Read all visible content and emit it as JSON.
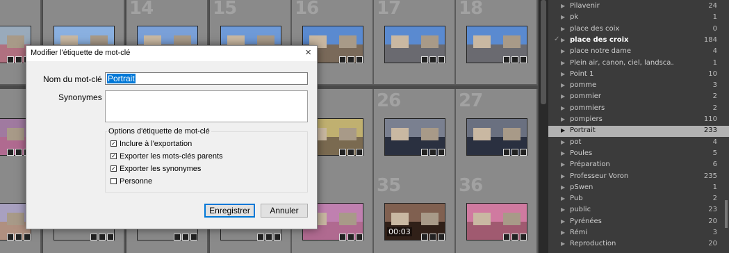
{
  "grid": {
    "cells": [
      {
        "num": "",
        "sky": "#9ab",
        "ground": "#b07080"
      },
      {
        "num": "",
        "sky": "#8ab0e0",
        "ground": "#a89070"
      },
      {
        "num": "14",
        "sky": "#7aa0d8",
        "ground": "#9a8060"
      },
      {
        "num": "15",
        "sky": "#6e9ad8",
        "ground": "#8a7a6a"
      },
      {
        "num": "16",
        "sky": "#5a8ad0",
        "ground": "#7a6a5a"
      },
      {
        "num": "17",
        "sky": "#5a8ad0",
        "ground": "#6a6a70"
      },
      {
        "num": "18",
        "sky": "#5a8ad0",
        "ground": "#6a6a70"
      },
      {
        "num": "",
        "sky": "#a07aa0",
        "ground": "#b06a90"
      },
      {
        "num": "",
        "sky": "#8a8a8a",
        "ground": "#8a8a8a"
      },
      {
        "num": "",
        "sky": "#8a8a8a",
        "ground": "#8a8a8a"
      },
      {
        "num": "",
        "sky": "#8a8a8a",
        "ground": "#8a8a8a"
      },
      {
        "num": "",
        "sky": "#c0b070",
        "ground": "#7a6a50"
      },
      {
        "num": "26",
        "sky": "#7a8090",
        "ground": "#2a3040"
      },
      {
        "num": "27",
        "sky": "#6a7080",
        "ground": "#2a3040"
      },
      {
        "num": "",
        "sky": "#a8a0c0",
        "ground": "#b09080"
      },
      {
        "num": "",
        "sky": "#8a8a8a",
        "ground": "#8a8a8a"
      },
      {
        "num": "",
        "sky": "#8a8a8a",
        "ground": "#8a8a8a"
      },
      {
        "num": "",
        "sky": "#8a8a8a",
        "ground": "#8a8a8a"
      },
      {
        "num": "",
        "sky": "#c080b0",
        "ground": "#b06a90"
      },
      {
        "num": "35",
        "sky": "#806050",
        "ground": "#302018"
      },
      {
        "num": "36",
        "sky": "#d07aa0",
        "ground": "#a05a70"
      }
    ],
    "video_time": "00:03"
  },
  "keywords": {
    "items": [
      {
        "label": "Pilavenir",
        "count": "24",
        "selected": false,
        "bold": false,
        "check": ""
      },
      {
        "label": "pk",
        "count": "1",
        "selected": false,
        "bold": false,
        "check": ""
      },
      {
        "label": "place des coix",
        "count": "0",
        "selected": false,
        "bold": false,
        "check": ""
      },
      {
        "label": "place des croix",
        "count": "184",
        "selected": false,
        "bold": true,
        "check": "✓"
      },
      {
        "label": "place notre dame",
        "count": "4",
        "selected": false,
        "bold": false,
        "check": ""
      },
      {
        "label": "Plein air, canon, ciel, landsca...",
        "count": "1",
        "selected": false,
        "bold": false,
        "check": ""
      },
      {
        "label": "Point 1",
        "count": "10",
        "selected": false,
        "bold": false,
        "check": ""
      },
      {
        "label": "pomme",
        "count": "3",
        "selected": false,
        "bold": false,
        "check": ""
      },
      {
        "label": "pommier",
        "count": "2",
        "selected": false,
        "bold": false,
        "check": ""
      },
      {
        "label": "pommiers",
        "count": "2",
        "selected": false,
        "bold": false,
        "check": ""
      },
      {
        "label": "pompiers",
        "count": "110",
        "selected": false,
        "bold": false,
        "check": ""
      },
      {
        "label": "Portrait",
        "count": "233",
        "selected": true,
        "bold": false,
        "check": ""
      },
      {
        "label": "pot",
        "count": "4",
        "selected": false,
        "bold": false,
        "check": ""
      },
      {
        "label": "Poules",
        "count": "5",
        "selected": false,
        "bold": false,
        "check": ""
      },
      {
        "label": "Préparation",
        "count": "6",
        "selected": false,
        "bold": false,
        "check": ""
      },
      {
        "label": "Professeur Voron",
        "count": "235",
        "selected": false,
        "bold": false,
        "check": ""
      },
      {
        "label": "pSwen",
        "count": "1",
        "selected": false,
        "bold": false,
        "check": ""
      },
      {
        "label": "Pub",
        "count": "2",
        "selected": false,
        "bold": false,
        "check": ""
      },
      {
        "label": "public",
        "count": "23",
        "selected": false,
        "bold": false,
        "check": ""
      },
      {
        "label": "Pyrénées",
        "count": "20",
        "selected": false,
        "bold": false,
        "check": ""
      },
      {
        "label": "Rémi",
        "count": "3",
        "selected": false,
        "bold": false,
        "check": ""
      },
      {
        "label": "Reproduction",
        "count": "20",
        "selected": false,
        "bold": false,
        "check": ""
      }
    ]
  },
  "dialog": {
    "title": "Modifier l'étiquette de mot-clé",
    "close_glyph": "×",
    "keyword_label": "Nom du mot-clé :",
    "keyword_value": "Portrait",
    "synonyms_label": "Synonymes :",
    "synonyms_value": "",
    "options_legend": "Options d'étiquette de mot-clé",
    "options": [
      {
        "label": "Inclure à l'exportation",
        "checked": true
      },
      {
        "label": "Exporter les mots-clés parents",
        "checked": true
      },
      {
        "label": "Exporter les synonymes",
        "checked": true
      },
      {
        "label": "Personne",
        "checked": false
      }
    ],
    "save_label": "Enregistrer",
    "cancel_label": "Annuler"
  },
  "colors": {
    "accent": "#0078d7",
    "selected_row": "#b2b2b2",
    "panel_bg": "#3b3b3b"
  }
}
